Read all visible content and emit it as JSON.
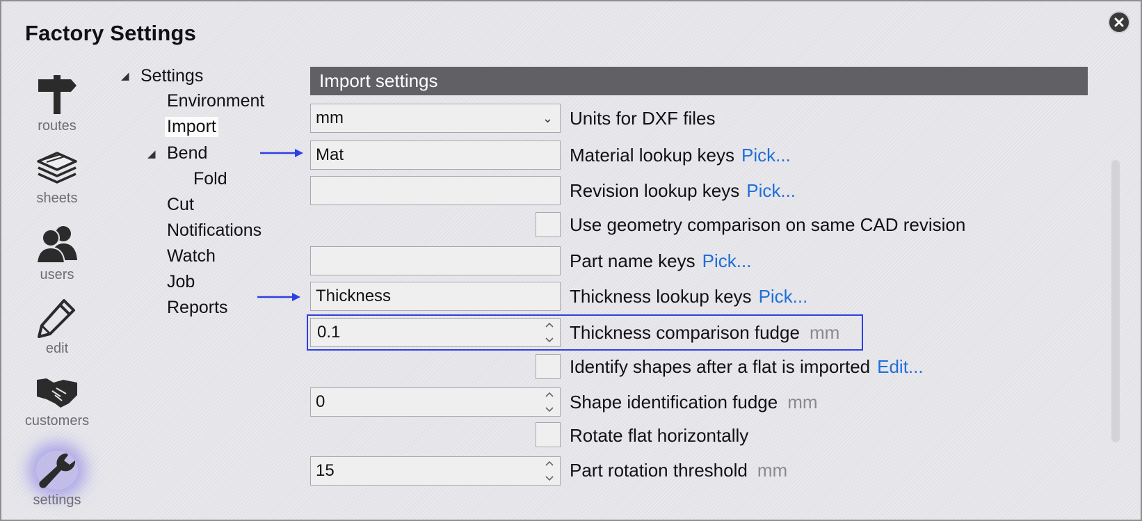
{
  "window": {
    "title": "Factory Settings"
  },
  "nav": [
    {
      "label": "routes",
      "icon": "signpost-icon"
    },
    {
      "label": "sheets",
      "icon": "layers-icon"
    },
    {
      "label": "users",
      "icon": "users-icon"
    },
    {
      "label": "edit",
      "icon": "pencil-icon"
    },
    {
      "label": "customers",
      "icon": "handshake-icon"
    },
    {
      "label": "settings",
      "icon": "wrench-icon",
      "active": true
    }
  ],
  "tree": {
    "root": "Settings",
    "children": [
      "Environment",
      "Import",
      "Bend",
      "Fold",
      "Cut",
      "Notifications",
      "Watch",
      "Job",
      "Reports"
    ],
    "selected": "Import"
  },
  "section": {
    "header": "Import settings"
  },
  "fields": {
    "units": {
      "value": "mm",
      "label": "Units for DXF files"
    },
    "material": {
      "value": "Mat",
      "label": "Material lookup keys",
      "link": "Pick..."
    },
    "revision": {
      "value": "",
      "label": "Revision lookup keys",
      "link": "Pick..."
    },
    "geometry": {
      "label": "Use geometry comparison on same CAD revision",
      "checked": false
    },
    "partname": {
      "value": "",
      "label": "Part name keys",
      "link": "Pick..."
    },
    "thickness": {
      "value": "Thickness",
      "label": "Thickness lookup keys",
      "link": "Pick..."
    },
    "thickness_fudge": {
      "value": "0.1",
      "label": "Thickness comparison fudge",
      "unit": "mm"
    },
    "identify": {
      "label": "Identify shapes after a flat is imported",
      "link": "Edit...",
      "checked": false
    },
    "shape_fudge": {
      "value": "0",
      "label": "Shape identification fudge",
      "unit": "mm"
    },
    "rotate": {
      "label": "Rotate flat horizontally",
      "checked": false
    },
    "rotation_threshold": {
      "value": "15",
      "label": "Part rotation threshold",
      "unit": "mm"
    }
  },
  "colors": {
    "accent_link": "#1e6fd8",
    "annotation": "#2f3fe0",
    "header_bg": "#606065"
  }
}
